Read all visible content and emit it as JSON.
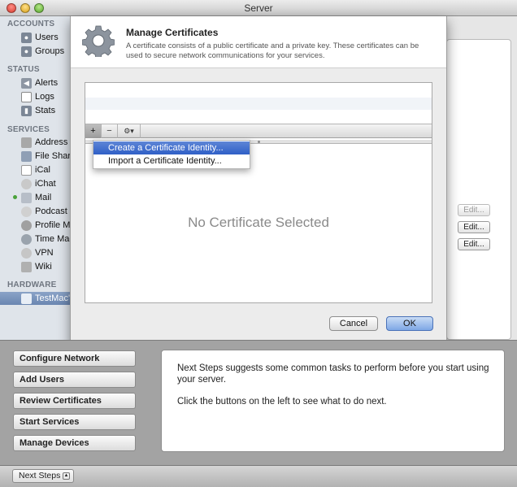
{
  "window": {
    "title": "Server"
  },
  "sidebar": {
    "sections": [
      {
        "heading": "ACCOUNTS",
        "items": [
          {
            "label": "Users",
            "icon": "users-icon"
          },
          {
            "label": "Groups",
            "icon": "groups-icon"
          }
        ]
      },
      {
        "heading": "STATUS",
        "items": [
          {
            "label": "Alerts",
            "icon": "alerts-icon"
          },
          {
            "label": "Logs",
            "icon": "logs-icon"
          },
          {
            "label": "Stats",
            "icon": "stats-icon"
          }
        ]
      },
      {
        "heading": "SERVICES",
        "items": [
          {
            "label": "Address Book",
            "icon": "address-book-icon"
          },
          {
            "label": "File Sharing",
            "icon": "file-sharing-icon"
          },
          {
            "label": "iCal",
            "icon": "ical-icon"
          },
          {
            "label": "iChat",
            "icon": "ichat-icon"
          },
          {
            "label": "Mail",
            "icon": "mail-icon",
            "status": "on"
          },
          {
            "label": "Podcast",
            "icon": "podcast-icon"
          },
          {
            "label": "Profile Manager",
            "icon": "profile-manager-icon"
          },
          {
            "label": "Time Machine",
            "icon": "time-machine-icon"
          },
          {
            "label": "VPN",
            "icon": "vpn-icon"
          },
          {
            "label": "Wiki",
            "icon": "wiki-icon"
          }
        ]
      },
      {
        "heading": "HARDWARE",
        "items": [
          {
            "label": "TestMac's",
            "icon": "computer-icon",
            "selected": true
          }
        ]
      }
    ]
  },
  "main": {
    "edit_label": "Edit..."
  },
  "sheet": {
    "title": "Manage Certificates",
    "description": "A certificate consists of a public certificate and a private key. These certificates can be used to secure network communications for your services.",
    "toolbar": {
      "add": "+",
      "remove": "−",
      "action": "⚙▾"
    },
    "empty_label": "No Certificate Selected",
    "menu": {
      "items": [
        "Create a Certificate Identity...",
        "Import a Certificate Identity..."
      ],
      "highlighted": 0
    },
    "buttons": {
      "cancel": "Cancel",
      "ok": "OK"
    }
  },
  "bottom": {
    "buttons": [
      "Configure Network",
      "Add Users",
      "Review Certificates",
      "Start Services",
      "Manage Devices"
    ],
    "panel": {
      "line1": "Next Steps suggests some common tasks to perform before you start using your server.",
      "line2": "Click the buttons on the left to see what to do next."
    }
  },
  "statusbar": {
    "next_steps_label": "Next Steps"
  },
  "colors": {
    "accent": "#2f5fc7",
    "sidebar_bg": "#dfe4ea",
    "status_on": "#4aa23a"
  }
}
